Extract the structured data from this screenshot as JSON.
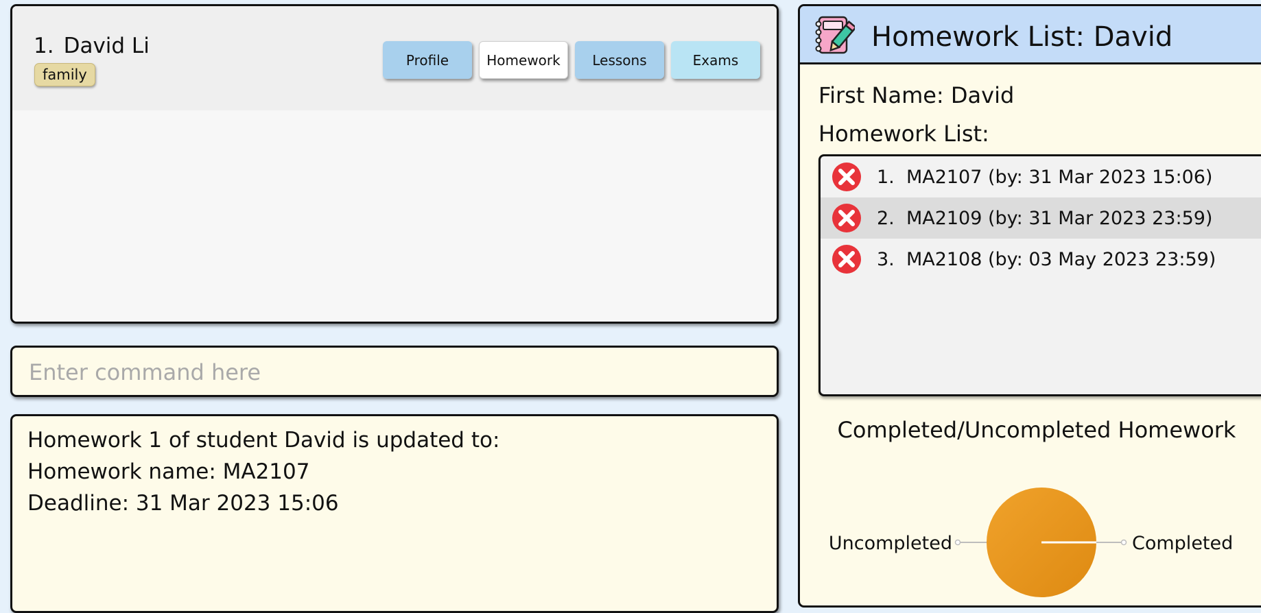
{
  "student_list": [
    {
      "index": "1.",
      "name": "David Li",
      "tags": [
        "family"
      ]
    }
  ],
  "tabs": [
    {
      "label": "Profile",
      "color": "#a8d0ed"
    },
    {
      "label": "Homework",
      "color": "#ffffff"
    },
    {
      "label": "Lessons",
      "color": "#a8d0ed"
    },
    {
      "label": "Exams",
      "color": "#b9e4f4"
    }
  ],
  "command": {
    "placeholder": "Enter command here",
    "value": ""
  },
  "result": {
    "lines": [
      "Homework 1 of student David is updated to:",
      "Homework name: MA2107",
      "Deadline: 31 Mar 2023 15:06"
    ]
  },
  "detail": {
    "title": "Homework List: David",
    "first_name": "First Name: David",
    "homework_label": "Homework List:",
    "homework": [
      {
        "index": "1.",
        "text": "MA2107 (by: 31 Mar 2023 15:06)",
        "status_icon": "cross-icon"
      },
      {
        "index": "2.",
        "text": "MA2109 (by: 31 Mar 2023 23:59)",
        "status_icon": "cross-icon"
      },
      {
        "index": "3.",
        "text": "MA2108 (by: 03 May 2023 23:59)",
        "status_icon": "cross-icon"
      }
    ]
  },
  "chart_data": {
    "type": "pie",
    "title": "Completed/Uncompleted Homework",
    "slices": [
      {
        "label": "Uncompleted",
        "value": 3
      },
      {
        "label": "Completed",
        "value": 0
      }
    ],
    "colors": {
      "pie_fill": "#f0a22b",
      "pie_fill_dark": "#de8a12",
      "leader": "#bdbdbd"
    }
  },
  "colors": {
    "background": "#e6f1fb",
    "panel_cream": "#fefbe9",
    "header_blue": "#c4dcf8",
    "tag": "#e6d9a3",
    "error_red": "#e8333a"
  }
}
